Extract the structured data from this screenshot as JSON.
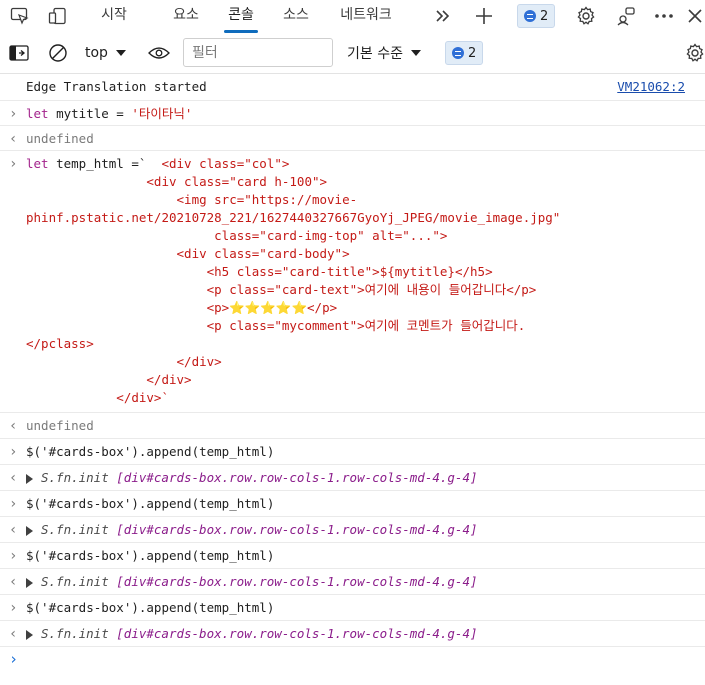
{
  "tabs": [
    {
      "label": "시작"
    },
    {
      "label": "요소"
    },
    {
      "label": "콘솔"
    },
    {
      "label": "소스"
    },
    {
      "label": "네트워크"
    }
  ],
  "issues_count": "2",
  "toolbar": {
    "context": "top",
    "filter_placeholder": "필터",
    "level": "기본 수준",
    "issues_count": "2"
  },
  "console": {
    "banner": "Edge Translation started",
    "banner_source": "VM21062:2",
    "undefined": "undefined",
    "cmd1_kw": "let",
    "cmd1_rest": " mytitle = ",
    "cmd1_str": "'타이타닉'",
    "cmd2_kw": "let",
    "cmd2_rest": " temp_html =`",
    "append_cmd": "$('#cards-box').append(temp_html)",
    "result_prefix": "S.fn.init ",
    "result_selector": "[div#cards-box.row.row-cols-1.row-cols-md-4.g-4]"
  },
  "template_lines": [
    "  <div class=\"col\">",
    "                <div class=\"card h-100\">",
    "                    <img src=\"https://movie-",
    "phinf.pstatic.net/20210728_221/1627440327667GyoYj_JPEG/movie_image.jpg\"",
    "                         class=\"card-img-top\" alt=\"...\">",
    "                    <div class=\"card-body\">",
    "                        <h5 class=\"card-title\">${mytitle}</h5>",
    "                        <p class=\"card-text\">여기에 내용이 들어갑니다</p>",
    "                        <p>⭐⭐⭐⭐⭐</p>",
    "                        <p class=\"mycomment\">여기에 코멘트가 들어갑니다.",
    "</pclass>",
    "                    </div>",
    "                </div>",
    "            </div>`"
  ]
}
